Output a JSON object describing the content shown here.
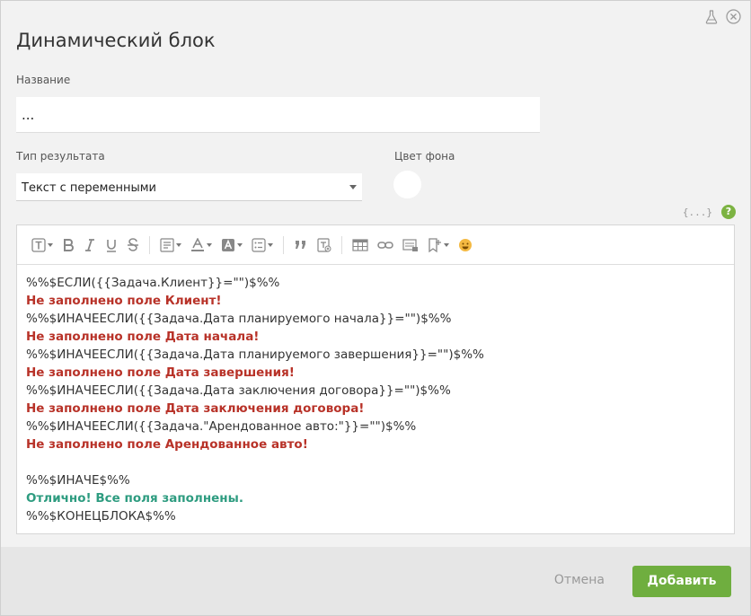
{
  "dialog": {
    "title": "Динамический блок",
    "top_icons": [
      "flask-icon",
      "close-icon"
    ]
  },
  "form": {
    "name_label": "Название",
    "name_value": "...",
    "type_label": "Тип результата",
    "type_value": "Текст с переменными",
    "color_label": "Цвет фона",
    "color_value": "#ffffff",
    "braces_text": "{...}",
    "help_text": "?"
  },
  "toolbar": {
    "icons": [
      "text-style-icon",
      "bold-icon",
      "italic-icon",
      "underline-icon",
      "strikethrough-icon",
      "paragraph-icon",
      "font-color-icon",
      "background-color-icon",
      "list-icon",
      "quote-icon",
      "clear-format-icon",
      "table-icon",
      "link-icon",
      "image-icon",
      "bookmark-icon",
      "emoji-icon"
    ]
  },
  "editor": {
    "lines": [
      {
        "text": "%%$ЕСЛИ({{Задача.Клиент}}=\"\")$%%",
        "style": "code"
      },
      {
        "text": "Не заполнено поле Клиент!",
        "style": "err"
      },
      {
        "text": "%%$ИНАЧЕЕСЛИ({{Задача.Дата планируемого начала}}=\"\")$%%",
        "style": "code"
      },
      {
        "text": "Не заполнено поле Дата начала!",
        "style": "err"
      },
      {
        "text": "%%$ИНАЧЕЕСЛИ({{Задача.Дата планируемого завершения}}=\"\")$%%",
        "style": "code"
      },
      {
        "text": "Не заполнено поле Дата завершения!",
        "style": "err"
      },
      {
        "text": "%%$ИНАЧЕЕСЛИ({{Задача.Дата заключения договора}}=\"\")$%%",
        "style": "code"
      },
      {
        "text": "Не заполнено поле Дата заключения договора!",
        "style": "err"
      },
      {
        "text": "%%$ИНАЧЕЕСЛИ({{Задача.\"Арендованное авто:\"}}=\"\")$%%",
        "style": "code"
      },
      {
        "text": "Не заполнено поле Арендованное авто!",
        "style": "err"
      },
      {
        "text": "",
        "style": "code"
      },
      {
        "text": "%%$ИНАЧЕ$%%",
        "style": "code"
      },
      {
        "text": "Отлично! Все поля заполнены.",
        "style": "ok"
      },
      {
        "text": "%%$КОНЕЦБЛОКА$%%",
        "style": "code"
      }
    ]
  },
  "footer": {
    "cancel_label": "Отмена",
    "add_label": "Добавить"
  },
  "colors": {
    "accent": "#6fae3f",
    "error_text": "#b83228",
    "success_text": "#2e9c80"
  }
}
